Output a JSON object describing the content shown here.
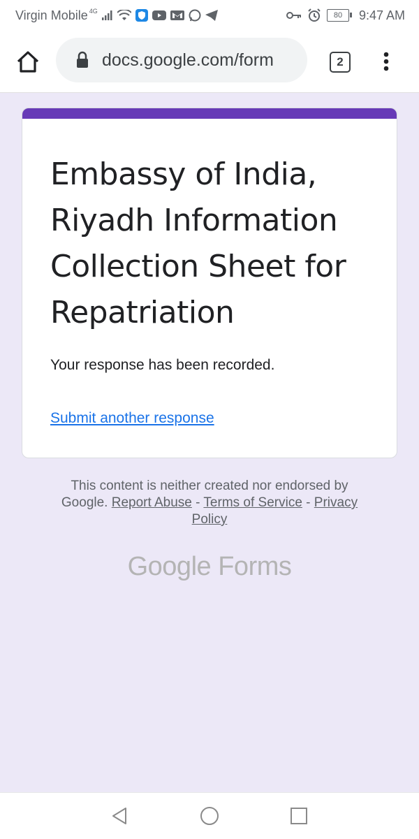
{
  "status_bar": {
    "carrier": "Virgin Mobile",
    "network": "4G",
    "battery": "80",
    "time": "9:47 AM",
    "icons": [
      "signal-icon",
      "wifi-icon",
      "shield-icon",
      "youtube-icon",
      "gmail-icon",
      "whatsapp-icon",
      "telegram-icon",
      "key-icon",
      "alarm-icon"
    ]
  },
  "browser": {
    "url": "docs.google.com/form",
    "tab_count": "2"
  },
  "form": {
    "accent_color": "#673ab7",
    "title": "Embassy of India, Riyadh Information Collection Sheet for Repatriation",
    "confirmation": "Your response has been recorded.",
    "submit_another": "Submit another response"
  },
  "footer": {
    "disclaimer": "This content is neither created nor endorsed by Google.",
    "report_abuse": "Report Abuse",
    "separator": " - ",
    "terms": "Terms of Service",
    "privacy": "Privacy Policy",
    "brand_google": "Google",
    "brand_forms": "Forms"
  }
}
